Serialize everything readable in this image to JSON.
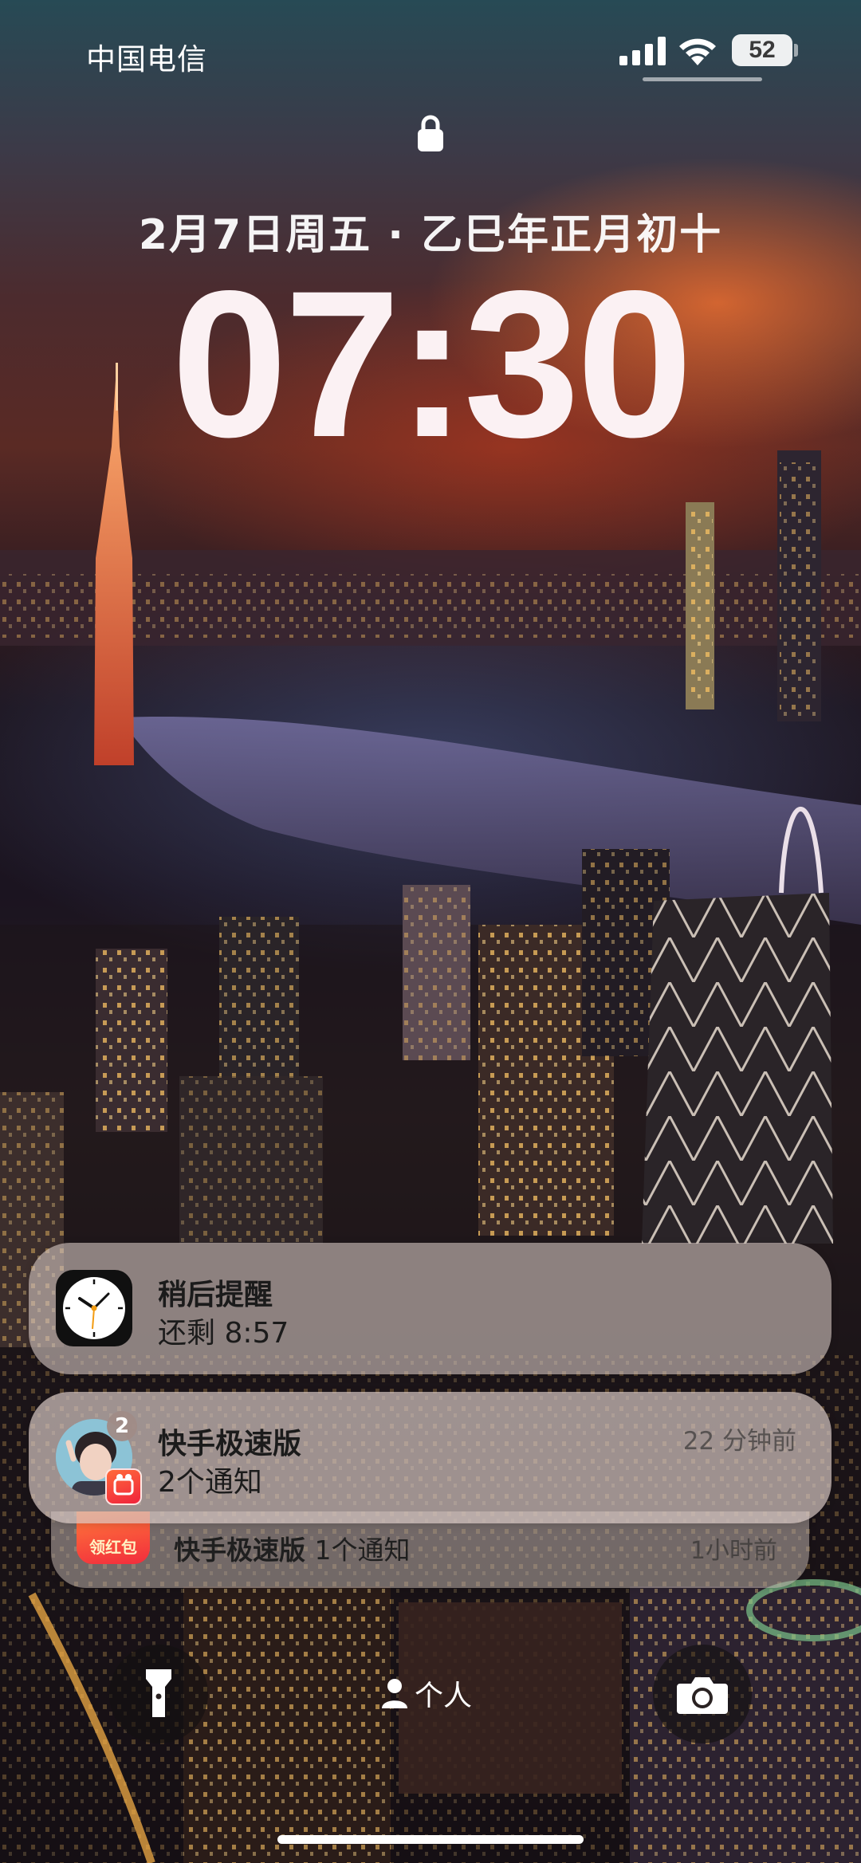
{
  "status_bar": {
    "carrier": "中国电信",
    "battery_level": "52",
    "signal_icon": "cellular-signal-icon",
    "wifi_icon": "wifi-icon"
  },
  "lock_screen": {
    "lock_icon": "lock-icon",
    "date": "2月7日周五 · 乙巳年正月初十",
    "time": "07:30"
  },
  "notifications": [
    {
      "app_icon": "clock-app-icon",
      "title": "稍后提醒",
      "body": "还剩 8:57",
      "time": ""
    },
    {
      "app_icon": "avatar",
      "badge_count": "2",
      "title": "快手极速版",
      "body": "2个通知",
      "time": "22 分钟前"
    }
  ],
  "notification_stack": {
    "icon_text": "领红包",
    "app": "快手极速版",
    "count_text": "1个通知",
    "time": "1小时前"
  },
  "bottom_controls": {
    "flashlight": "flashlight-icon",
    "focus_label": "个人",
    "camera": "camera-icon"
  },
  "colors": {
    "notification_bg": "#d2c3be",
    "clock_text": "#fbf1f3",
    "control_bg": "#141010"
  }
}
